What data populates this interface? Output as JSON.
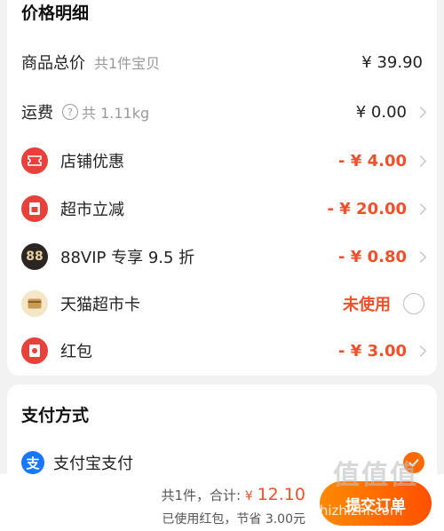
{
  "price_section": {
    "title": "价格明细",
    "rows": {
      "goods_total": {
        "label": "商品总价",
        "sub": "共1件宝贝",
        "value": "¥ 39.90"
      },
      "shipping": {
        "label": "运费",
        "sub": "共 1.11kg",
        "value": "¥ 0.00"
      },
      "shop_discount": {
        "label": "店铺优惠",
        "value": "- ¥ 4.00",
        "icon": "ticket-icon"
      },
      "market_discount": {
        "label": "超市立减",
        "value": "- ¥ 20.00",
        "icon": "red-envelope-jian-icon"
      },
      "vip_discount": {
        "label": "88VIP 专享 9.5 折",
        "value": "- ¥ 0.80",
        "icon": "88vip-icon",
        "icon_text": "88"
      },
      "market_card": {
        "label": "天猫超市卡",
        "value": "未使用",
        "icon": "card-icon"
      },
      "red_packet": {
        "label": "红包",
        "value": "- ¥ 3.00",
        "icon": "red-packet-icon"
      }
    }
  },
  "payment_section": {
    "title": "支付方式",
    "alipay": {
      "label": "支付宝支付",
      "icon": "alipay-icon",
      "icon_text": "支"
    }
  },
  "bottom_bar": {
    "count_text": "共1件，",
    "total_label": "合计:",
    "currency": "¥",
    "total_amount": "12.10",
    "saving_text": "已使用红包，节省 3.00元",
    "submit_label": "提交订单"
  },
  "watermark": {
    "text": "值值值",
    "url": "zhizhizhi.com"
  },
  "colors": {
    "accent": "#f0502a",
    "orange": "#ff5000",
    "icon_red": "#e8413c",
    "vip_dark": "#2b2622"
  }
}
